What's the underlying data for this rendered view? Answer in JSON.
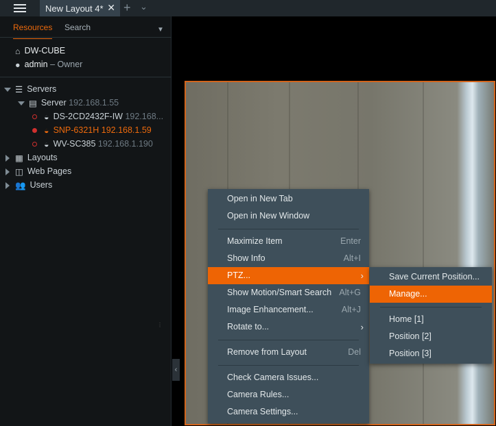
{
  "topbar": {
    "tab_label": "New Layout 4*",
    "close": "✕",
    "add": "+",
    "more": "⌄"
  },
  "sidebar": {
    "tabs": [
      "Resources",
      "Search"
    ],
    "system": "DW-CUBE",
    "user": "admin",
    "user_role": "– Owner",
    "servers_label": "Servers",
    "server": {
      "name": "Server",
      "ip": "192.168.1.55"
    },
    "cameras": [
      {
        "name": "DS-2CD2432F-IW",
        "ip": "192.168...",
        "status": "offline"
      },
      {
        "name": "SNP-6321H",
        "ip": "192.168.1.59",
        "status": "recording"
      },
      {
        "name": "WV-SC385",
        "ip": "192.168.1.190",
        "status": "offline"
      }
    ],
    "layouts": "Layouts",
    "web_pages": "Web Pages",
    "users": "Users"
  },
  "context_menu": {
    "items": [
      {
        "label": "Open in New Tab"
      },
      {
        "label": "Open in New Window"
      },
      {
        "label": "Maximize Item",
        "shortcut": "Enter"
      },
      {
        "label": "Show Info",
        "shortcut": "Alt+I"
      },
      {
        "label": "PTZ..."
      },
      {
        "label": "Show Motion/Smart Search",
        "shortcut": "Alt+G"
      },
      {
        "label": "Image Enhancement...",
        "shortcut": "Alt+J"
      },
      {
        "label": "Rotate to..."
      },
      {
        "label": "Remove from Layout",
        "shortcut": "Del"
      },
      {
        "label": "Check Camera Issues..."
      },
      {
        "label": "Camera Rules..."
      },
      {
        "label": "Camera Settings..."
      }
    ]
  },
  "ptz_submenu": {
    "items": [
      "Save Current Position...",
      "Manage...",
      "Home [1]",
      "Position [2]",
      "Position [3]"
    ]
  },
  "colors": {
    "accent": "#ee6404",
    "menu_bg": "#3e4f5a"
  }
}
